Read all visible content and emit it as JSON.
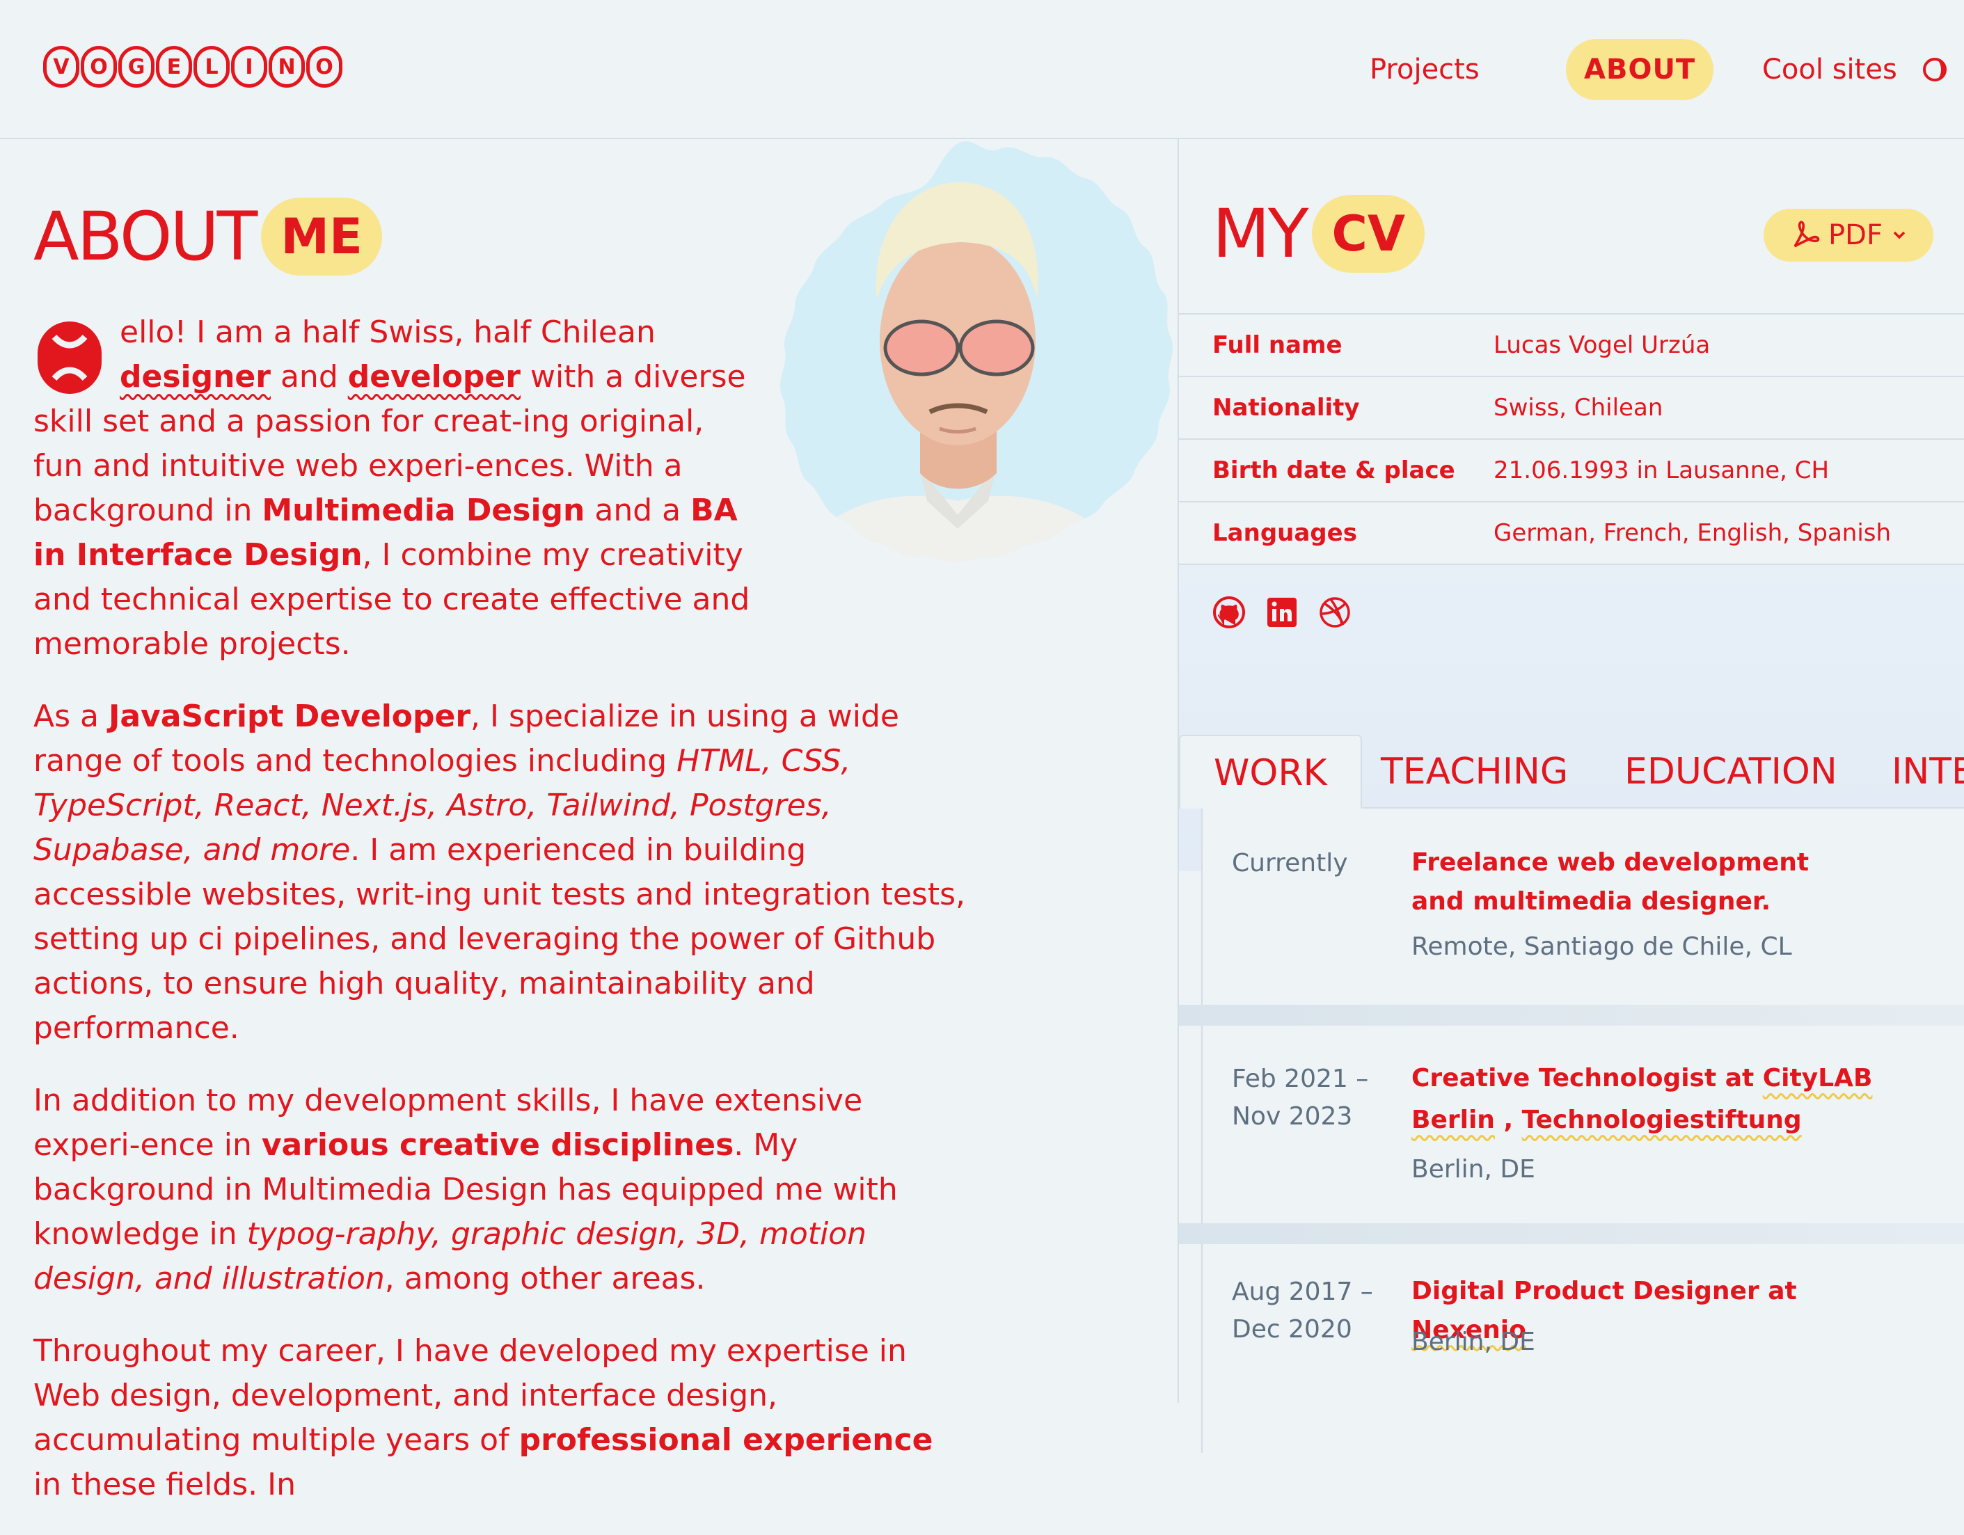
{
  "header": {
    "logo_letters": [
      "V",
      "O",
      "G",
      "E",
      "L",
      "I",
      "N",
      "O"
    ],
    "nav": {
      "projects": "Projects",
      "about": "ABOUT",
      "cool_sites": "Cool sites"
    }
  },
  "about": {
    "title": "ABOUT",
    "title_pill": "ME",
    "dropcap": "H",
    "p1": {
      "t1": "ello! I am a half Swiss, half Chilean",
      "designer": "designer",
      "t2": " and ",
      "developer": "developer",
      "t3": " with a diverse skill set and a passion for creat-ing original, fun and intuitive web experi-ences. With a background in ",
      "b1": "Multimedia Design",
      "t4": " and a ",
      "b2": "BA in Interface Design",
      "t5": ", I combine my creativity and technical expertise to create effective and memorable projects."
    },
    "p2": {
      "t1": "As a ",
      "b1": "JavaScript Developer",
      "t2": ", I specialize in using a wide range of tools and technologies including ",
      "i1": "HTML, CSS, TypeScript, React, Next.js, Astro, Tailwind, Postgres, Supabase, and more",
      "t3": ". I am experienced in building accessible websites, writ-ing unit tests and integration tests, setting up ci pipelines, and leveraging the power of Github actions, to ensure high quality, maintainability and performance."
    },
    "p3": {
      "t1": "In addition to my development skills, I have extensive experi-ence in ",
      "b1": "various creative disciplines",
      "t2": ". My background in Multimedia Design has equipped me with knowledge in ",
      "i1": "typog-raphy, graphic design, 3D, motion design, and illustration",
      "t3": ", among other areas."
    },
    "p4": {
      "t1": "Throughout my career, I have developed my expertise in Web design, development, and interface design, accumulating multiple years of ",
      "b1": "professional experience",
      "t2": " in these fields. In"
    }
  },
  "cv": {
    "title": "MY",
    "title_pill": "CV",
    "pdf_label": "PDF",
    "info": [
      {
        "key": "Full name",
        "value": "Lucas Vogel Urzúa"
      },
      {
        "key": "Nationality",
        "value": "Swiss, Chilean"
      },
      {
        "key": "Birth date & place",
        "value": "21.06.1993 in Lausanne, CH"
      },
      {
        "key": "Languages",
        "value": "German, French, English, Spanish"
      }
    ],
    "tabs": [
      "WORK",
      "TEACHING",
      "EDUCATION",
      "INTE"
    ],
    "timeline": [
      {
        "date": "Currently",
        "title_1": "Freelance web development",
        "title_2": "and multimedia designer.",
        "location": "Remote, Santiago de Chile, CL"
      },
      {
        "date_1": "Feb 2021 –",
        "date_2": "Nov 2023",
        "title_a": "Creative Technologist at ",
        "title_link1": "CityLAB",
        "title_link2": "Berlin",
        "title_sep": " , ",
        "title_link3": "Technologiestiftung",
        "location": "Berlin, DE"
      },
      {
        "date_1": "Aug 2017 –",
        "date_2": "Dec 2020",
        "title_a": "Digital Product Designer at ",
        "title_link1": "Nexenio",
        "location": "Berlin, DE"
      }
    ]
  },
  "colors": {
    "accent": "#e2161d",
    "highlight": "#f9e58e",
    "background": "#eef3f6",
    "muted_text": "#5d6f80"
  },
  "icons": [
    "theme-toggle-icon",
    "pdf-icon",
    "chevron-down-icon",
    "github-icon",
    "linkedin-icon",
    "dribbble-icon"
  ]
}
